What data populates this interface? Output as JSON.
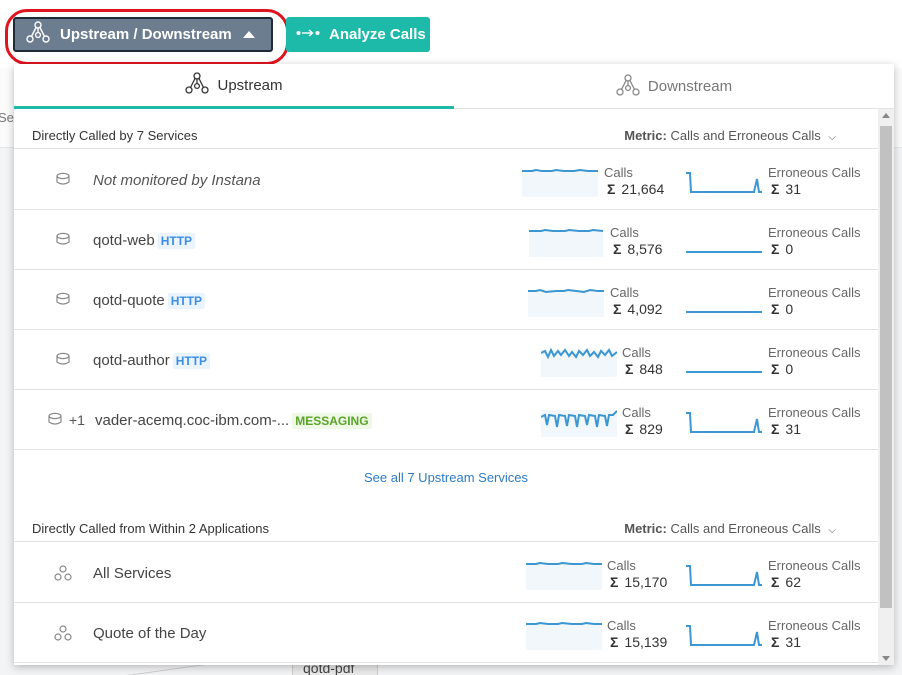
{
  "background": {
    "fragment_text": "Ser",
    "node_label": "qotd-pdf"
  },
  "toolbar": {
    "updown_label": "Upstream / Downstream",
    "analyze_label": "Analyze Calls",
    "accent_color": "#1dbaa9",
    "highlight_color": "#e0141e"
  },
  "tabs": [
    {
      "label": "Upstream",
      "icon": "hierarchy-up-icon",
      "active": true
    },
    {
      "label": "Downstream",
      "icon": "hierarchy-down-icon",
      "active": false
    }
  ],
  "upstream": {
    "title": "Directly Called by 7 Services",
    "metric_prefix": "Metric:",
    "metric_value": "Calls and Erroneous Calls",
    "see_all": "See all 7 Upstream Services",
    "rows": [
      {
        "icon": "database-icon",
        "name": "Not monitored by Instana",
        "tag": "",
        "prefix": "",
        "calls_label": "Calls",
        "sigma": "Σ",
        "calls": "21,664",
        "err_label": "Erroneous Calls",
        "errors": "31"
      },
      {
        "icon": "database-icon",
        "name": "qotd-web",
        "tag": "HTTP",
        "prefix": "",
        "calls_label": "Calls",
        "sigma": "Σ",
        "calls": "8,576",
        "err_label": "Erroneous Calls",
        "errors": "0"
      },
      {
        "icon": "database-icon",
        "name": "qotd-quote",
        "tag": "HTTP",
        "prefix": "",
        "calls_label": "Calls",
        "sigma": "Σ",
        "calls": "4,092",
        "err_label": "Erroneous Calls",
        "errors": "0"
      },
      {
        "icon": "database-icon",
        "name": "qotd-author",
        "tag": "HTTP",
        "prefix": "",
        "calls_label": "Calls",
        "sigma": "Σ",
        "calls": "848",
        "err_label": "Erroneous Calls",
        "errors": "0"
      },
      {
        "icon": "database-icon",
        "name": "vader-acemq.coc-ibm.com-...",
        "tag": "MESSAGING",
        "prefix": "+1",
        "calls_label": "Calls",
        "sigma": "Σ",
        "calls": "829",
        "err_label": "Erroneous Calls",
        "errors": "31"
      }
    ]
  },
  "applications": {
    "title": "Directly Called from Within 2 Applications",
    "metric_prefix": "Metric:",
    "metric_value": "Calls and Erroneous Calls",
    "rows": [
      {
        "icon": "application-icon",
        "name": "All Services",
        "calls_label": "Calls",
        "sigma": "Σ",
        "calls": "15,170",
        "err_label": "Erroneous Calls",
        "errors": "62"
      },
      {
        "icon": "application-icon",
        "name": "Quote of the Day",
        "calls_label": "Calls",
        "sigma": "Σ",
        "calls": "15,139",
        "err_label": "Erroneous Calls",
        "errors": "31"
      }
    ]
  }
}
